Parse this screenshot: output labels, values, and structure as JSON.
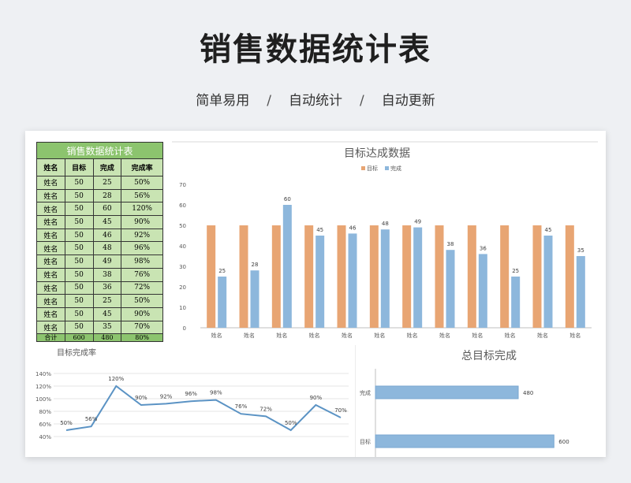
{
  "page": {
    "title": "销售数据统计表",
    "subtitle": [
      "简单易用",
      "自动统计",
      "自动更新"
    ],
    "separator": "/"
  },
  "table": {
    "title": "销售数据统计表",
    "headers": [
      "姓名",
      "目标",
      "完成",
      "完成率"
    ],
    "rows": [
      [
        "姓名",
        "50",
        "25",
        "50%"
      ],
      [
        "姓名",
        "50",
        "28",
        "56%"
      ],
      [
        "姓名",
        "50",
        "60",
        "120%"
      ],
      [
        "姓名",
        "50",
        "45",
        "90%"
      ],
      [
        "姓名",
        "50",
        "46",
        "92%"
      ],
      [
        "姓名",
        "50",
        "48",
        "96%"
      ],
      [
        "姓名",
        "50",
        "49",
        "98%"
      ],
      [
        "姓名",
        "50",
        "38",
        "76%"
      ],
      [
        "姓名",
        "50",
        "36",
        "72%"
      ],
      [
        "姓名",
        "50",
        "25",
        "50%"
      ],
      [
        "姓名",
        "50",
        "45",
        "90%"
      ],
      [
        "姓名",
        "50",
        "35",
        "70%"
      ]
    ],
    "total": [
      "合计",
      "600",
      "480",
      "80%"
    ]
  },
  "chart_data": [
    {
      "type": "bar",
      "title": "目标达成数据",
      "categories": [
        "姓名",
        "姓名",
        "姓名",
        "姓名",
        "姓名",
        "姓名",
        "姓名",
        "姓名",
        "姓名",
        "姓名",
        "姓名",
        "姓名"
      ],
      "series": [
        {
          "name": "目标",
          "values": [
            50,
            50,
            50,
            50,
            50,
            50,
            50,
            50,
            50,
            50,
            50,
            50
          ],
          "color": "#e8a573"
        },
        {
          "name": "完成",
          "values": [
            25,
            28,
            60,
            45,
            46,
            48,
            49,
            38,
            36,
            25,
            45,
            35
          ],
          "color": "#8db7dc"
        }
      ],
      "ylim": [
        0,
        70
      ],
      "yticks": [
        0,
        10,
        20,
        30,
        40,
        50,
        60,
        70
      ],
      "legend": "top-center",
      "data_labels_series": "完成"
    },
    {
      "type": "line",
      "title": "目标完成率",
      "values": [
        50,
        56,
        120,
        90,
        92,
        96,
        98,
        76,
        72,
        50,
        90,
        70
      ],
      "labels": [
        "50%",
        "56%",
        "120%",
        "90%",
        "92%",
        "96%",
        "98%",
        "76%",
        "72%",
        "50%",
        "90%",
        "70%"
      ],
      "ylim": [
        40,
        140
      ],
      "yticks": [
        "40%",
        "60%",
        "80%",
        "100%",
        "120%",
        "140%"
      ],
      "color": "#5b93c4"
    },
    {
      "type": "bar",
      "orientation": "horizontal",
      "title": "总目标完成",
      "categories": [
        "完成",
        "目标"
      ],
      "values": [
        480,
        600
      ],
      "labels": [
        "480",
        "600"
      ],
      "xlim": [
        0,
        700
      ],
      "color": "#8db7dc"
    }
  ]
}
